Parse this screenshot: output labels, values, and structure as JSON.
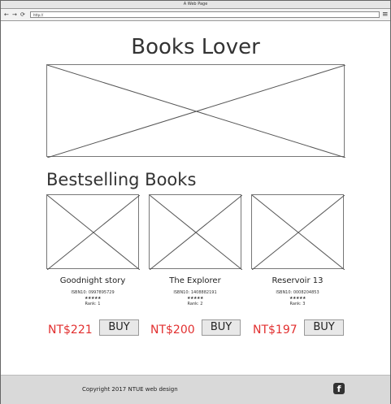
{
  "window": {
    "title": "A Web Page",
    "back_icon": "←",
    "forward_icon": "→",
    "refresh_icon": "⟳",
    "url": "http://",
    "menu_icon": "≡"
  },
  "header": {
    "title": "Books Lover"
  },
  "section": {
    "title": "Bestselling Books"
  },
  "books": [
    {
      "title": "Goodnight story",
      "isbn": "ISBN10: 0997895729",
      "stars": "★★★★★",
      "rank": "Rank: 1",
      "price": "NT$221",
      "buy_label": "BUY"
    },
    {
      "title": "The Explorer",
      "isbn": "ISBN10: 1408882191",
      "stars": "★★★★★",
      "rank": "Rank: 2",
      "price": "NT$200",
      "buy_label": "BUY"
    },
    {
      "title": "Reservoir 13",
      "isbn": "ISBN10: 0008204853",
      "stars": "★★★★★",
      "rank": "Rank: 3",
      "price": "NT$197",
      "buy_label": "BUY"
    }
  ],
  "footer": {
    "copyright": "Copyright  2017 NTUE web design",
    "social_icon": "f"
  },
  "colors": {
    "price": "#e23030",
    "footer_bg": "#d9d9d9",
    "button_bg": "#e8e8e8"
  }
}
